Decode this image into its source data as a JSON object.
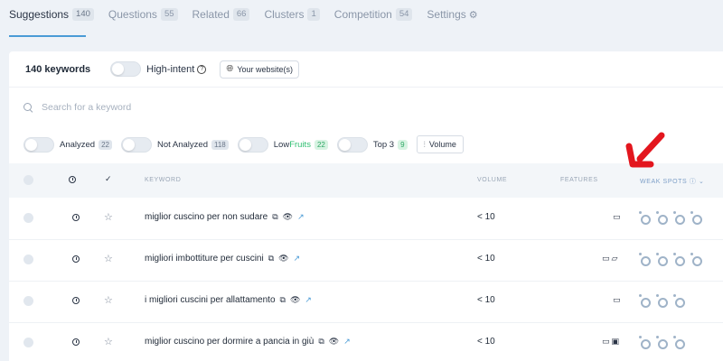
{
  "tabs": [
    {
      "label": "Suggestions",
      "count": "140"
    },
    {
      "label": "Questions",
      "count": "55"
    },
    {
      "label": "Related",
      "count": "66"
    },
    {
      "label": "Clusters",
      "count": "1"
    },
    {
      "label": "Competition",
      "count": "54"
    },
    {
      "label": "Settings",
      "count": ""
    }
  ],
  "toolbar": {
    "keyword_count": "140 keywords",
    "high_intent": "High-intent",
    "website_button": "Your website(s)"
  },
  "search": {
    "placeholder": "Search for a keyword"
  },
  "filters": {
    "analyzed": {
      "label": "Analyzed",
      "count": "22"
    },
    "not_analyzed": {
      "label": "Not Analyzed",
      "count": "118"
    },
    "lowfruits": {
      "label_a": "Low",
      "label_b": "Fruits",
      "count": "22"
    },
    "top3": {
      "label": "Top 3",
      "count": "9"
    },
    "volume_button": "Volume"
  },
  "table": {
    "headers": {
      "keyword": "KEYWORD",
      "volume": "VOLUME",
      "features": "FEATURES",
      "weak_spots": "WEAK SPOTS"
    },
    "rows": [
      {
        "keyword": "miglior cuscino per non sudare",
        "volume": "< 10",
        "features": [
          "card-icon"
        ],
        "weak_spots": 4
      },
      {
        "keyword": "migliori imbottiture per cuscini",
        "volume": "< 10",
        "features": [
          "card-icon",
          "map-icon"
        ],
        "weak_spots": 4
      },
      {
        "keyword": "i migliori cuscini per allattamento",
        "volume": "< 10",
        "features": [
          "card-icon"
        ],
        "weak_spots": 3
      },
      {
        "keyword": "miglior cuscino per dormire a pancia in giù",
        "volume": "< 10",
        "features": [
          "card-icon",
          "image-icon"
        ],
        "weak_spots": 3
      }
    ]
  },
  "colors": {
    "accent": "#4a9bd6",
    "arrow": "#e3161e",
    "ring": "#9fb3c8",
    "green": "#2fbf71"
  }
}
